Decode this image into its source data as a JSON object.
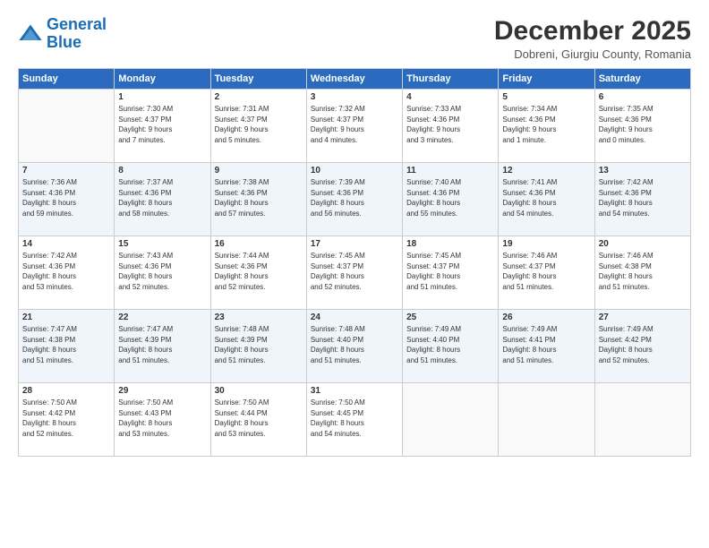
{
  "logo": {
    "line1": "General",
    "line2": "Blue"
  },
  "title": "December 2025",
  "subtitle": "Dobreni, Giurgiu County, Romania",
  "weekdays": [
    "Sunday",
    "Monday",
    "Tuesday",
    "Wednesday",
    "Thursday",
    "Friday",
    "Saturday"
  ],
  "weeks": [
    [
      {
        "day": "",
        "info": ""
      },
      {
        "day": "1",
        "info": "Sunrise: 7:30 AM\nSunset: 4:37 PM\nDaylight: 9 hours\nand 7 minutes."
      },
      {
        "day": "2",
        "info": "Sunrise: 7:31 AM\nSunset: 4:37 PM\nDaylight: 9 hours\nand 5 minutes."
      },
      {
        "day": "3",
        "info": "Sunrise: 7:32 AM\nSunset: 4:37 PM\nDaylight: 9 hours\nand 4 minutes."
      },
      {
        "day": "4",
        "info": "Sunrise: 7:33 AM\nSunset: 4:36 PM\nDaylight: 9 hours\nand 3 minutes."
      },
      {
        "day": "5",
        "info": "Sunrise: 7:34 AM\nSunset: 4:36 PM\nDaylight: 9 hours\nand 1 minute."
      },
      {
        "day": "6",
        "info": "Sunrise: 7:35 AM\nSunset: 4:36 PM\nDaylight: 9 hours\nand 0 minutes."
      }
    ],
    [
      {
        "day": "7",
        "info": "Sunrise: 7:36 AM\nSunset: 4:36 PM\nDaylight: 8 hours\nand 59 minutes."
      },
      {
        "day": "8",
        "info": "Sunrise: 7:37 AM\nSunset: 4:36 PM\nDaylight: 8 hours\nand 58 minutes."
      },
      {
        "day": "9",
        "info": "Sunrise: 7:38 AM\nSunset: 4:36 PM\nDaylight: 8 hours\nand 57 minutes."
      },
      {
        "day": "10",
        "info": "Sunrise: 7:39 AM\nSunset: 4:36 PM\nDaylight: 8 hours\nand 56 minutes."
      },
      {
        "day": "11",
        "info": "Sunrise: 7:40 AM\nSunset: 4:36 PM\nDaylight: 8 hours\nand 55 minutes."
      },
      {
        "day": "12",
        "info": "Sunrise: 7:41 AM\nSunset: 4:36 PM\nDaylight: 8 hours\nand 54 minutes."
      },
      {
        "day": "13",
        "info": "Sunrise: 7:42 AM\nSunset: 4:36 PM\nDaylight: 8 hours\nand 54 minutes."
      }
    ],
    [
      {
        "day": "14",
        "info": "Sunrise: 7:42 AM\nSunset: 4:36 PM\nDaylight: 8 hours\nand 53 minutes."
      },
      {
        "day": "15",
        "info": "Sunrise: 7:43 AM\nSunset: 4:36 PM\nDaylight: 8 hours\nand 52 minutes."
      },
      {
        "day": "16",
        "info": "Sunrise: 7:44 AM\nSunset: 4:36 PM\nDaylight: 8 hours\nand 52 minutes."
      },
      {
        "day": "17",
        "info": "Sunrise: 7:45 AM\nSunset: 4:37 PM\nDaylight: 8 hours\nand 52 minutes."
      },
      {
        "day": "18",
        "info": "Sunrise: 7:45 AM\nSunset: 4:37 PM\nDaylight: 8 hours\nand 51 minutes."
      },
      {
        "day": "19",
        "info": "Sunrise: 7:46 AM\nSunset: 4:37 PM\nDaylight: 8 hours\nand 51 minutes."
      },
      {
        "day": "20",
        "info": "Sunrise: 7:46 AM\nSunset: 4:38 PM\nDaylight: 8 hours\nand 51 minutes."
      }
    ],
    [
      {
        "day": "21",
        "info": "Sunrise: 7:47 AM\nSunset: 4:38 PM\nDaylight: 8 hours\nand 51 minutes."
      },
      {
        "day": "22",
        "info": "Sunrise: 7:47 AM\nSunset: 4:39 PM\nDaylight: 8 hours\nand 51 minutes."
      },
      {
        "day": "23",
        "info": "Sunrise: 7:48 AM\nSunset: 4:39 PM\nDaylight: 8 hours\nand 51 minutes."
      },
      {
        "day": "24",
        "info": "Sunrise: 7:48 AM\nSunset: 4:40 PM\nDaylight: 8 hours\nand 51 minutes."
      },
      {
        "day": "25",
        "info": "Sunrise: 7:49 AM\nSunset: 4:40 PM\nDaylight: 8 hours\nand 51 minutes."
      },
      {
        "day": "26",
        "info": "Sunrise: 7:49 AM\nSunset: 4:41 PM\nDaylight: 8 hours\nand 51 minutes."
      },
      {
        "day": "27",
        "info": "Sunrise: 7:49 AM\nSunset: 4:42 PM\nDaylight: 8 hours\nand 52 minutes."
      }
    ],
    [
      {
        "day": "28",
        "info": "Sunrise: 7:50 AM\nSunset: 4:42 PM\nDaylight: 8 hours\nand 52 minutes."
      },
      {
        "day": "29",
        "info": "Sunrise: 7:50 AM\nSunset: 4:43 PM\nDaylight: 8 hours\nand 53 minutes."
      },
      {
        "day": "30",
        "info": "Sunrise: 7:50 AM\nSunset: 4:44 PM\nDaylight: 8 hours\nand 53 minutes."
      },
      {
        "day": "31",
        "info": "Sunrise: 7:50 AM\nSunset: 4:45 PM\nDaylight: 8 hours\nand 54 minutes."
      },
      {
        "day": "",
        "info": ""
      },
      {
        "day": "",
        "info": ""
      },
      {
        "day": "",
        "info": ""
      }
    ]
  ]
}
